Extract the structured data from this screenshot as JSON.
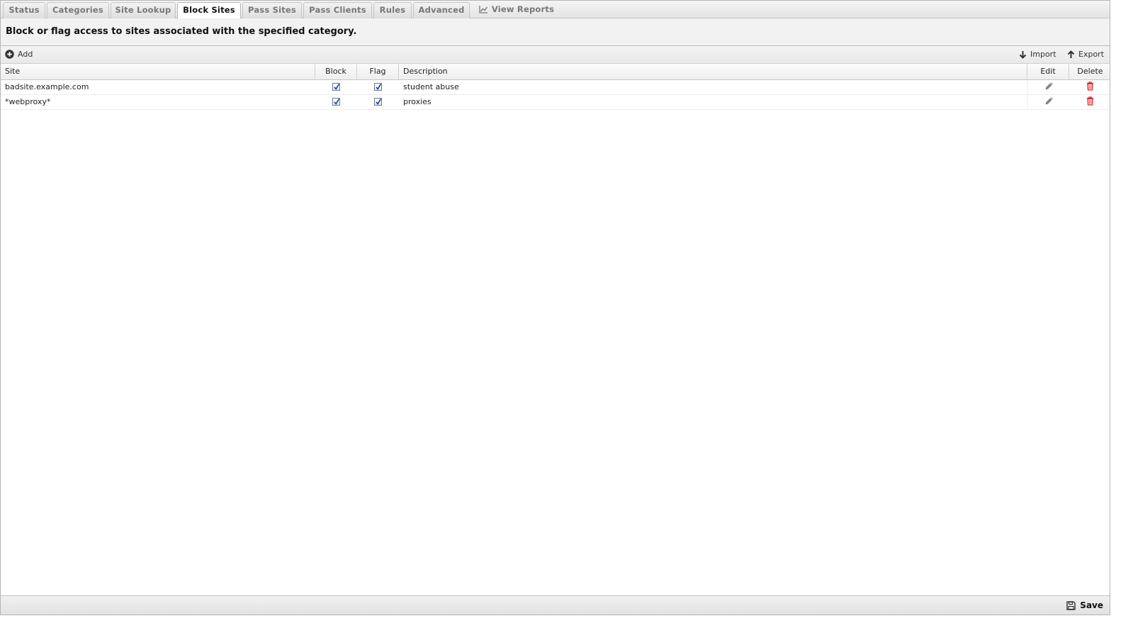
{
  "tabs": [
    {
      "label": "Status"
    },
    {
      "label": "Categories"
    },
    {
      "label": "Site Lookup"
    },
    {
      "label": "Block Sites",
      "active": true
    },
    {
      "label": "Pass Sites"
    },
    {
      "label": "Pass Clients"
    },
    {
      "label": "Rules"
    },
    {
      "label": "Advanced"
    },
    {
      "label": "View Reports",
      "icon": "line-chart-icon"
    }
  ],
  "description": "Block or flag access to sites associated with the specified category.",
  "toolbar": {
    "add_label": "Add",
    "import_label": "Import",
    "export_label": "Export"
  },
  "grid": {
    "columns": {
      "site": "Site",
      "block": "Block",
      "flag": "Flag",
      "description": "Description",
      "edit": "Edit",
      "delete": "Delete"
    },
    "rows": [
      {
        "site": "badsite.example.com",
        "block": true,
        "flag": true,
        "description": "student abuse"
      },
      {
        "site": "*webproxy*",
        "block": true,
        "flag": true,
        "description": "proxies"
      }
    ]
  },
  "footer": {
    "save_label": "Save"
  },
  "colors": {
    "delete_icon": "#e0242b",
    "checkmark": "#1c3f94"
  }
}
